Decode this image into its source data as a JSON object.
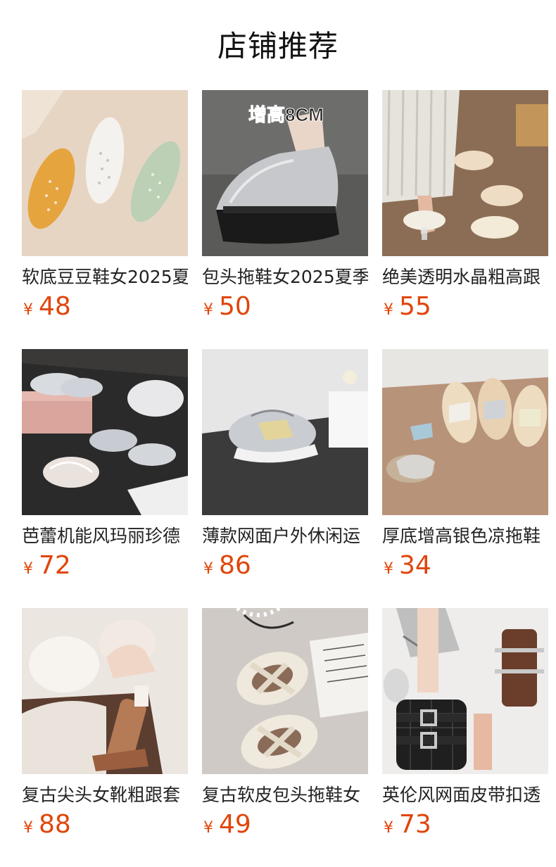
{
  "header": {
    "title": "店铺推荐"
  },
  "currency_symbol": "¥",
  "accent_color": "#e0460b",
  "products": [
    {
      "title": "软底豆豆鞋女2025夏",
      "price": "48",
      "image": "hollow-flats-yellow-white-mint"
    },
    {
      "title": "包头拖鞋女2025夏季",
      "price": "50",
      "image": "silver-platform-mule",
      "image_badge": "增高8CM"
    },
    {
      "title": "绝美透明水晶粗高跟",
      "price": "55",
      "image": "clear-heel-slides"
    },
    {
      "title": "芭蕾机能风玛丽珍德",
      "price": "72",
      "image": "silver-mary-jane-ballet"
    },
    {
      "title": "薄款网面户外休闲运",
      "price": "86",
      "image": "silver-mesh-sneaker"
    },
    {
      "title": "厚底增高银色凉拖鞋",
      "price": "34",
      "image": "woven-platform-slides"
    },
    {
      "title": "复古尖头女靴粗跟套",
      "price": "88",
      "image": "brown-western-boots"
    },
    {
      "title": "复古软皮包头拖鞋女",
      "price": "49",
      "image": "cream-woven-mules"
    },
    {
      "title": "英伦风网面皮带扣透",
      "price": "73",
      "image": "mesh-buckle-boots"
    }
  ]
}
